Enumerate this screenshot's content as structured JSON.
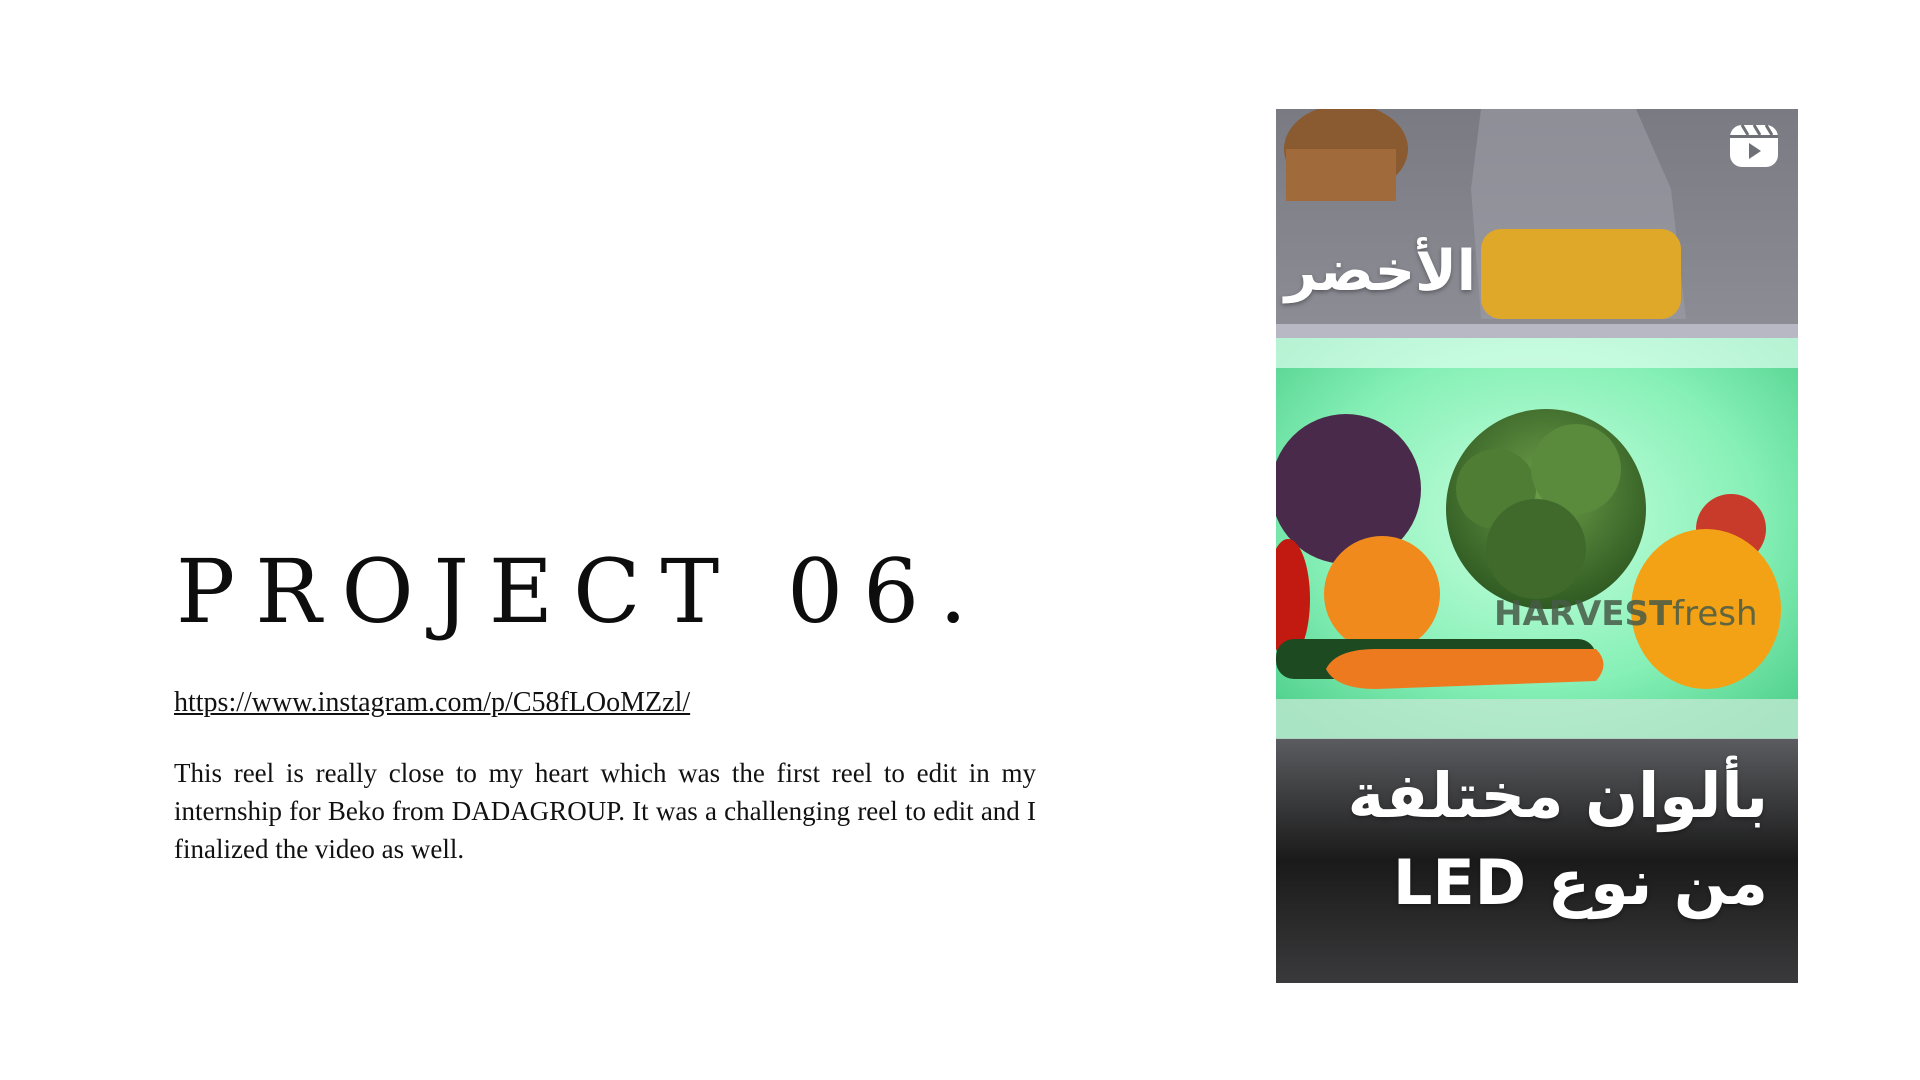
{
  "project": {
    "title": "PROJECT 06.",
    "link": "https://www.instagram.com/p/C58fLOoMZzl/",
    "description": "This reel is really close to my heart which was the first reel to edit in my internship for Beko from DADAGROUP. It was a challenging reel to edit and I finalized the video as well."
  },
  "reel": {
    "icon": "reels-icon",
    "overlay_top": "الأخضر",
    "overlay_line1": "بألوان مختلفة",
    "overlay_line2": "من نوع LED",
    "brand_bold": "HARVEST",
    "brand_light": "fresh"
  },
  "colors": {
    "background": "#ffffff",
    "text": "#111111",
    "fridge_glow": "#7ef0b0"
  }
}
